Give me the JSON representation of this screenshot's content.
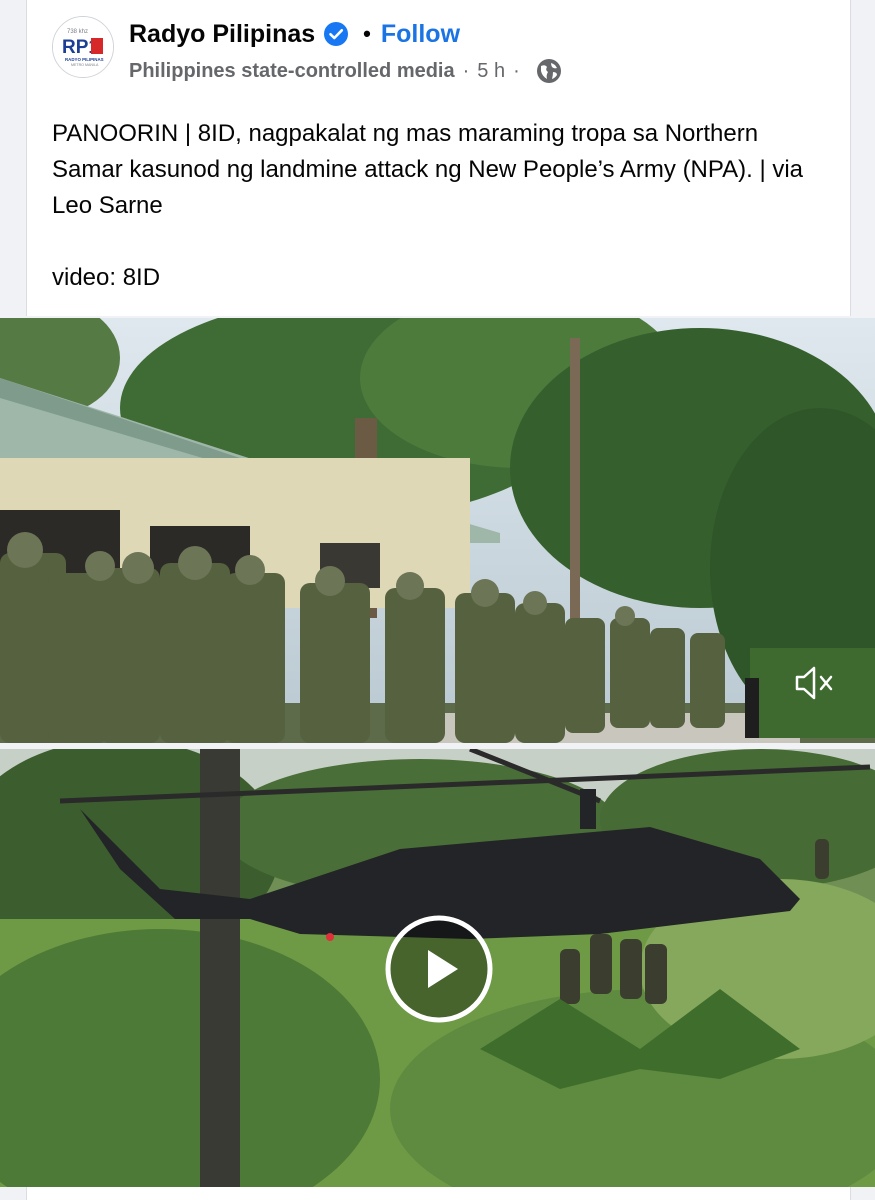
{
  "post": {
    "page_name": "Radyo Pilipinas",
    "follow_label": "Follow",
    "separator": "•",
    "state_label": "Philippines state-controlled media",
    "meta_separator": "·",
    "time": "5 h",
    "text_line1": "PANOORIN | 8ID, nagpakalat ng mas maraming tropa sa Northern Samar kasunod ng landmine attack ng New People’s Army (NPA). | via Leo Sarne",
    "text_line2": "video: 8ID"
  },
  "logo": {
    "brand": "RP1",
    "badge": "738 khz",
    "line1": "RADYO PILIPINAS",
    "line2": "METRO MANILA"
  },
  "icons": {
    "verified": "verified-badge-icon",
    "globe": "globe-icon",
    "mute": "speaker-muted-icon",
    "play": "play-icon"
  },
  "colors": {
    "accent": "#1b74e4",
    "verified": "#1877f2",
    "text": "#050505",
    "meta": "#65676b"
  }
}
